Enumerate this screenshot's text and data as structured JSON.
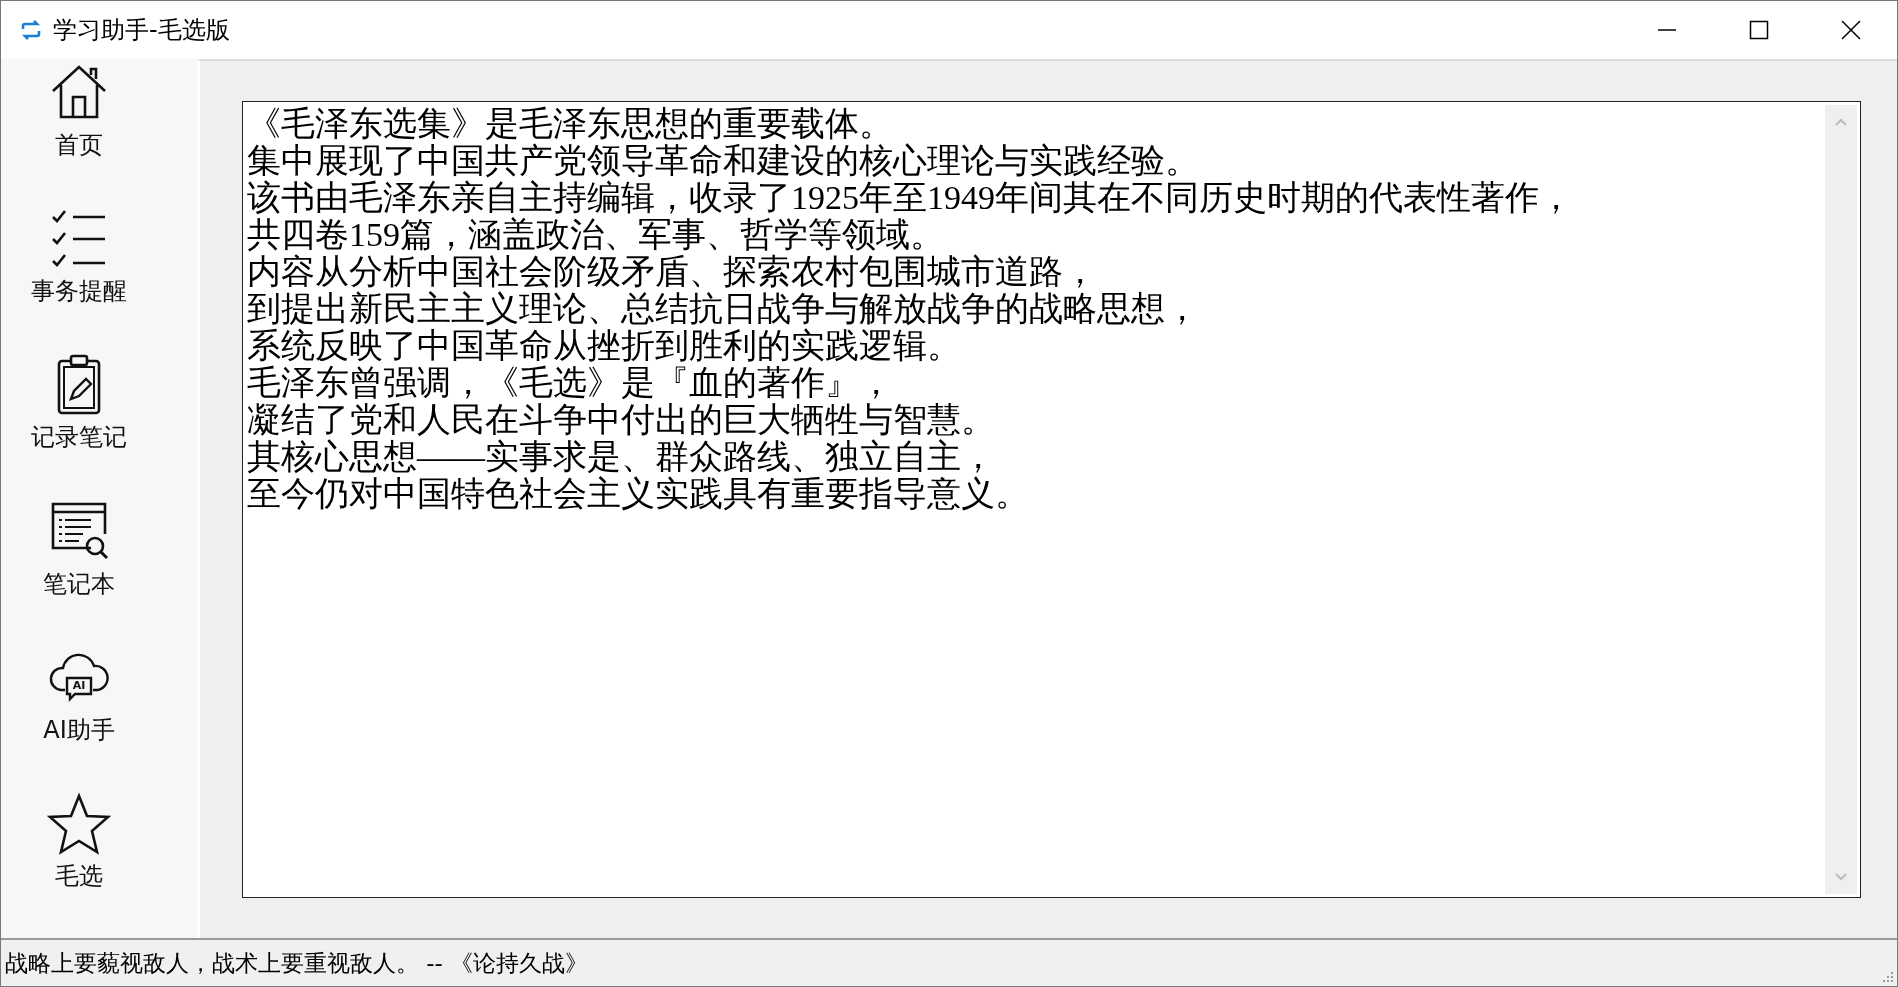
{
  "window": {
    "title": "学习助手-毛选版"
  },
  "sidebar": {
    "items": [
      {
        "kind": "home",
        "label": "首页"
      },
      {
        "kind": "checklist",
        "label": "事务提醒"
      },
      {
        "kind": "clipboard",
        "label": "记录笔记"
      },
      {
        "kind": "notebook",
        "label": "笔记本"
      },
      {
        "kind": "ai",
        "label": "AI助手",
        "icon_text": "AI"
      },
      {
        "kind": "star",
        "label": "毛选"
      }
    ]
  },
  "editor": {
    "lines": [
      "《毛泽东选集》是毛泽东思想的重要载体。",
      "集中展现了中国共产党领导革命和建设的核心理论与实践经验。",
      "该书由毛泽东亲自主持编辑，收录了1925年至1949年间其在不同历史时期的代表性著作，",
      "共四卷159篇，涵盖政治、军事、哲学等领域。",
      "内容从分析中国社会阶级矛盾、探索农村包围城市道路，",
      "到提出新民主主义理论、总结抗日战争与解放战争的战略思想，",
      "系统反映了中国革命从挫折到胜利的实践逻辑。",
      "毛泽东曾强调，《毛选》是『血的著作』，",
      "凝结了党和人民在斗争中付出的巨大牺牲与智慧。",
      "其核心思想——实事求是、群众路线、独立自主，",
      "至今仍对中国特色社会主义实践具有重要指导意义。"
    ]
  },
  "status_bar": {
    "text": "战略上要藐视敌人，战术上要重视敌人。 -- 《论持久战》"
  }
}
